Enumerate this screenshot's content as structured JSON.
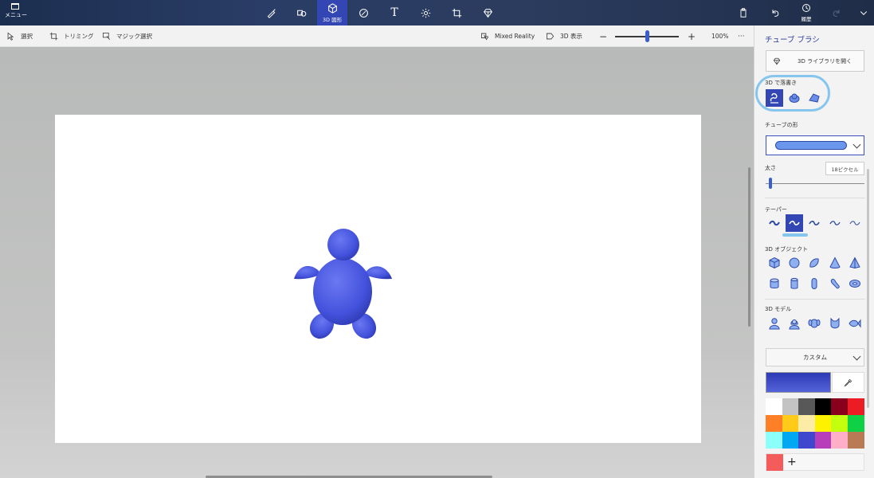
{
  "topbar": {
    "menu_label": "メニュー",
    "tools": [
      {
        "name": "brush",
        "label": ""
      },
      {
        "name": "2d-shapes",
        "label": ""
      },
      {
        "name": "3d-shapes",
        "label": "3D 図形"
      },
      {
        "name": "stickers",
        "label": ""
      },
      {
        "name": "text",
        "label": "T"
      },
      {
        "name": "effects",
        "label": ""
      },
      {
        "name": "canvas",
        "label": ""
      },
      {
        "name": "3d-library",
        "label": ""
      }
    ],
    "history_label": "履歴"
  },
  "toolbar": {
    "select_label": "選択",
    "crop_label": "トリミング",
    "magic_select_label": "マジック選択",
    "mixed_reality_label": "Mixed Reality",
    "view3d_label": "3D 表示",
    "zoom_minus": "−",
    "zoom_plus": "+",
    "zoom_level": "100%",
    "more": "···",
    "zoom_value_fraction": 0.5
  },
  "panel": {
    "title": "チューブ ブラシ",
    "library_button": "3D ライブラリを開く",
    "doodle_label": "3D で落書き",
    "tube_shape_label": "チューブの形",
    "thickness_label": "太さ",
    "thickness_value": "18ピクセル",
    "taper_label": "テーパー",
    "objects_label": "3D オブジェクト",
    "models_label": "3D モデル",
    "color_mode": "カスタム",
    "selected_color": "#3a48c8",
    "swatch_colors": [
      "#ffffff",
      "#c3c3c3",
      "#585858",
      "#000000",
      "#88001b",
      "#ec1c24",
      "#ff7f27",
      "#ffca18",
      "#fdeca6",
      "#fff200",
      "#c4ff0e",
      "#0ed145",
      "#8cfffb",
      "#00a8f3",
      "#3f48cc",
      "#b83dba",
      "#ffaec8",
      "#b97a56"
    ],
    "custom_color": "#f45b5b",
    "add_color": "+"
  },
  "colors": {
    "accent": "#3346b4",
    "turtle": "#4a58e0",
    "highlight": "#86c6ee"
  }
}
